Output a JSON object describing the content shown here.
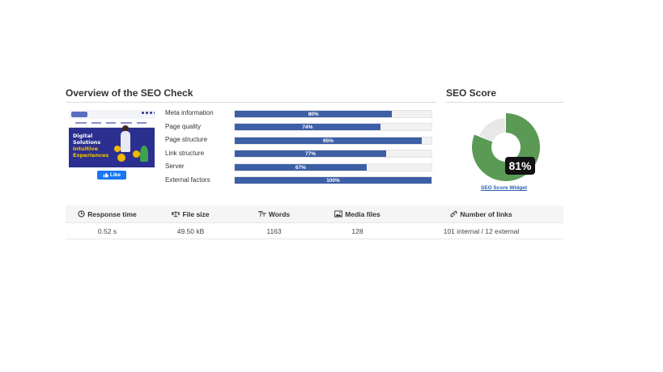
{
  "overview": {
    "title": "Overview of the SEO Check",
    "preview": {
      "hero_line1": "Digital",
      "hero_line2": "Solutions",
      "hero_line3": "Intuitive",
      "hero_line4": "Experiences"
    },
    "like_label": "Like",
    "metrics": [
      {
        "label": "Meta information",
        "value": 80,
        "text": "80%"
      },
      {
        "label": "Page quality",
        "value": 74,
        "text": "74%"
      },
      {
        "label": "Page structure",
        "value": 95,
        "text": "95%"
      },
      {
        "label": "Link structure",
        "value": 77,
        "text": "77%"
      },
      {
        "label": "Server",
        "value": 67,
        "text": "67%"
      },
      {
        "label": "External factors",
        "value": 100,
        "text": "100%"
      }
    ],
    "bar_color": "#3d5fa6"
  },
  "score": {
    "title": "SEO Score",
    "value": 81,
    "text": "81%",
    "widget_link": "SEO Score Widget",
    "good_color": "#5b9a55",
    "rest_color": "#e8e8e8"
  },
  "stats": {
    "headers": [
      {
        "label": "Response time",
        "icon": "clock-icon"
      },
      {
        "label": "File size",
        "icon": "scale-icon"
      },
      {
        "label": "Words",
        "icon": "text-size-icon"
      },
      {
        "label": "Media files",
        "icon": "image-icon"
      },
      {
        "label": "Number of links",
        "icon": "link-icon"
      }
    ],
    "values": [
      "0.52 s",
      "49.50 kB",
      "1163",
      "128",
      "101 internal / 12 external"
    ]
  }
}
